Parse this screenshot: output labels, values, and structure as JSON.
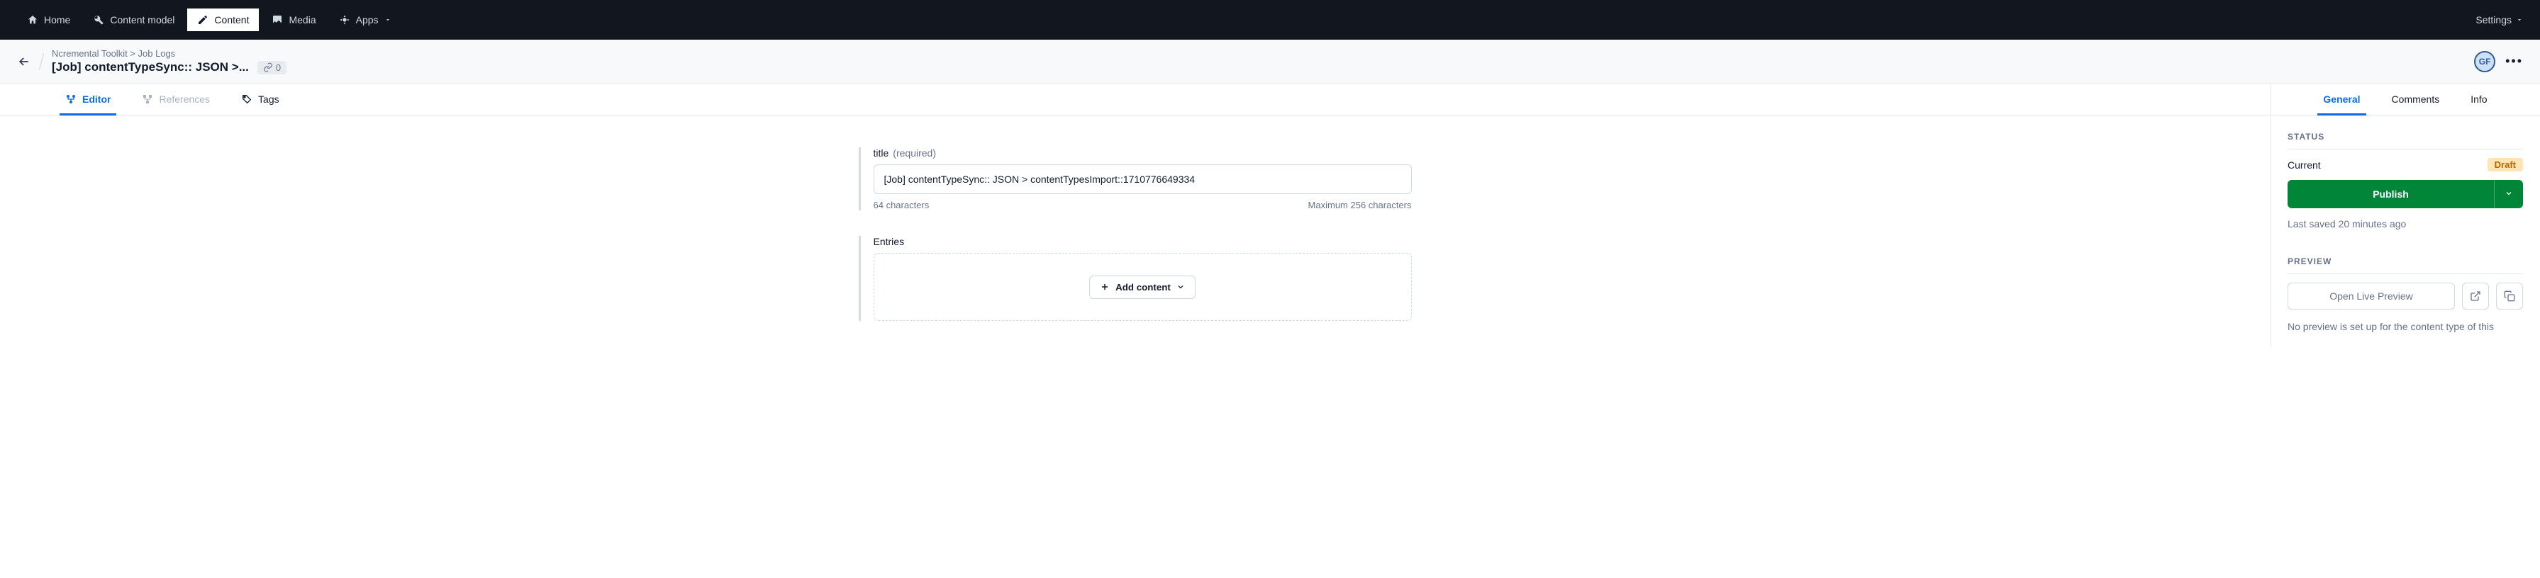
{
  "topnav": {
    "items": [
      {
        "label": "Home",
        "icon": "home"
      },
      {
        "label": "Content model",
        "icon": "wrench"
      },
      {
        "label": "Content",
        "icon": "pencil",
        "active": true
      },
      {
        "label": "Media",
        "icon": "media"
      },
      {
        "label": "Apps",
        "icon": "apps",
        "caret": true
      }
    ],
    "settings_label": "Settings"
  },
  "subheader": {
    "breadcrumb": "Ncremental Toolkit > Job Logs",
    "title": "[Job] contentTypeSync:: JSON >...",
    "linked_count": "0",
    "avatar_initials": "GF"
  },
  "main_tabs": [
    {
      "label": "Editor",
      "icon": "editor",
      "active": true
    },
    {
      "label": "References",
      "icon": "refs",
      "disabled": true
    },
    {
      "label": "Tags",
      "icon": "tag"
    }
  ],
  "fields": {
    "title": {
      "label": "title",
      "required": "(required)",
      "value": "[Job] contentTypeSync:: JSON > contentTypesImport::1710776649334",
      "char_count": "64 characters",
      "max_hint": "Maximum 256 characters"
    },
    "entries": {
      "label": "Entries",
      "add_button": "Add content"
    }
  },
  "sidebar": {
    "tabs": [
      {
        "label": "General",
        "active": true
      },
      {
        "label": "Comments"
      },
      {
        "label": "Info"
      }
    ],
    "status": {
      "heading": "STATUS",
      "current_label": "Current",
      "badge": "Draft",
      "publish": "Publish",
      "last_saved": "Last saved 20 minutes ago"
    },
    "preview": {
      "heading": "PREVIEW",
      "open_label": "Open Live Preview",
      "note": "No preview is set up for the content type of this"
    }
  }
}
